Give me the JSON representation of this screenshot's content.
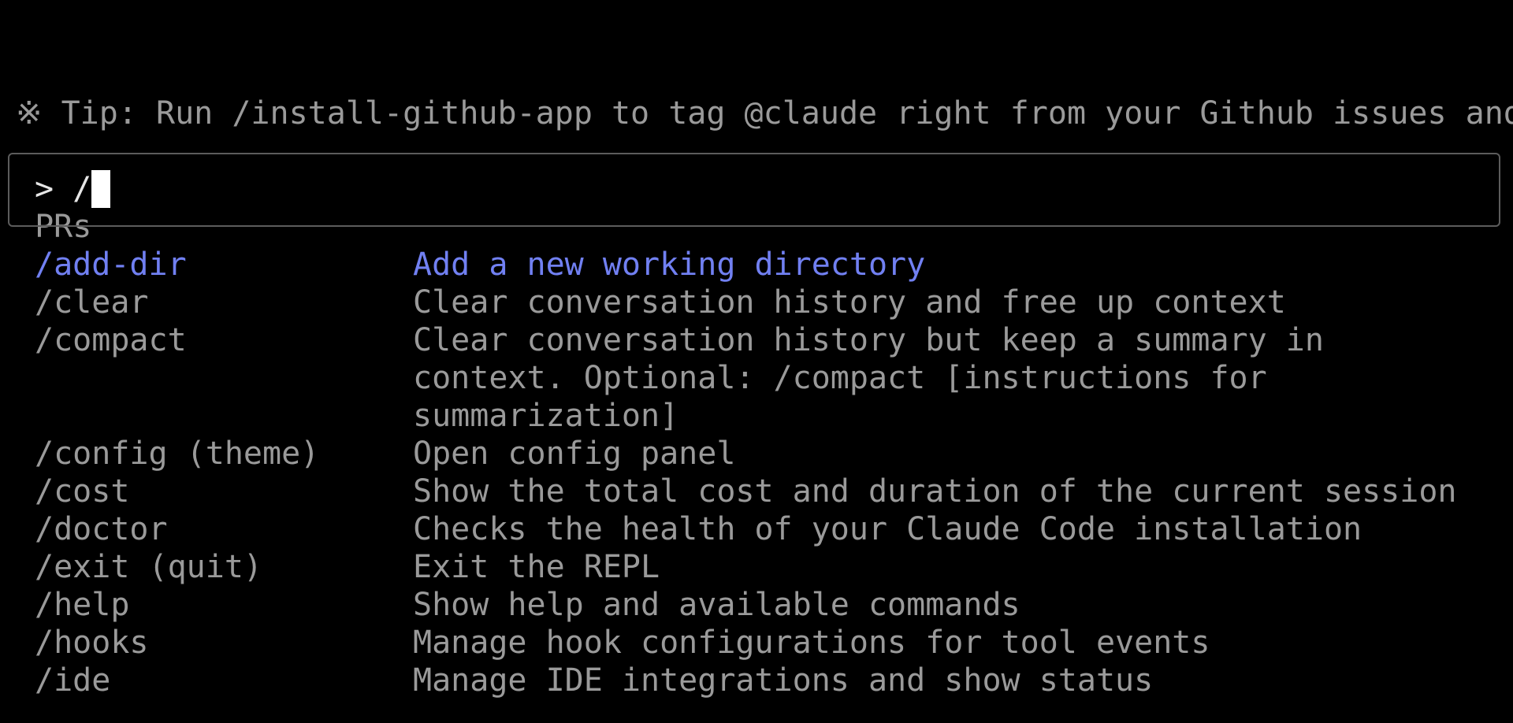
{
  "tip": {
    "lines": [
      "※ Tip: Run /install-github-app to tag @claude right from your Github issues and",
      " PRs"
    ]
  },
  "prompt": {
    "symbol": "> /"
  },
  "commands": [
    {
      "name": "/add-dir",
      "description": [
        "Add a new working directory"
      ]
    },
    {
      "name": "/clear",
      "description": [
        "Clear conversation history and free up context"
      ]
    },
    {
      "name": "/compact",
      "description": [
        "Clear conversation history but keep a summary in",
        "context. Optional: /compact [instructions for",
        "summarization]"
      ]
    },
    {
      "name": "/config (theme)",
      "description": [
        "Open config panel"
      ]
    },
    {
      "name": "/cost",
      "description": [
        "Show the total cost and duration of the current session"
      ]
    },
    {
      "name": "/doctor",
      "description": [
        "Checks the health of your Claude Code installation"
      ]
    },
    {
      "name": "/exit (quit)",
      "description": [
        "Exit the REPL"
      ]
    },
    {
      "name": "/help",
      "description": [
        "Show help and available commands"
      ]
    },
    {
      "name": "/hooks",
      "description": [
        "Manage hook configurations for tool events"
      ]
    },
    {
      "name": "/ide",
      "description": [
        "Manage IDE integrations and show status"
      ]
    }
  ],
  "selected_index": 0,
  "colors": {
    "background": "#000000",
    "text_dim": "#9a9a9a",
    "text_bright": "#e6e6e6",
    "selected": "#7180f2",
    "border": "#5c5c5c",
    "cursor": "#ffffff"
  }
}
